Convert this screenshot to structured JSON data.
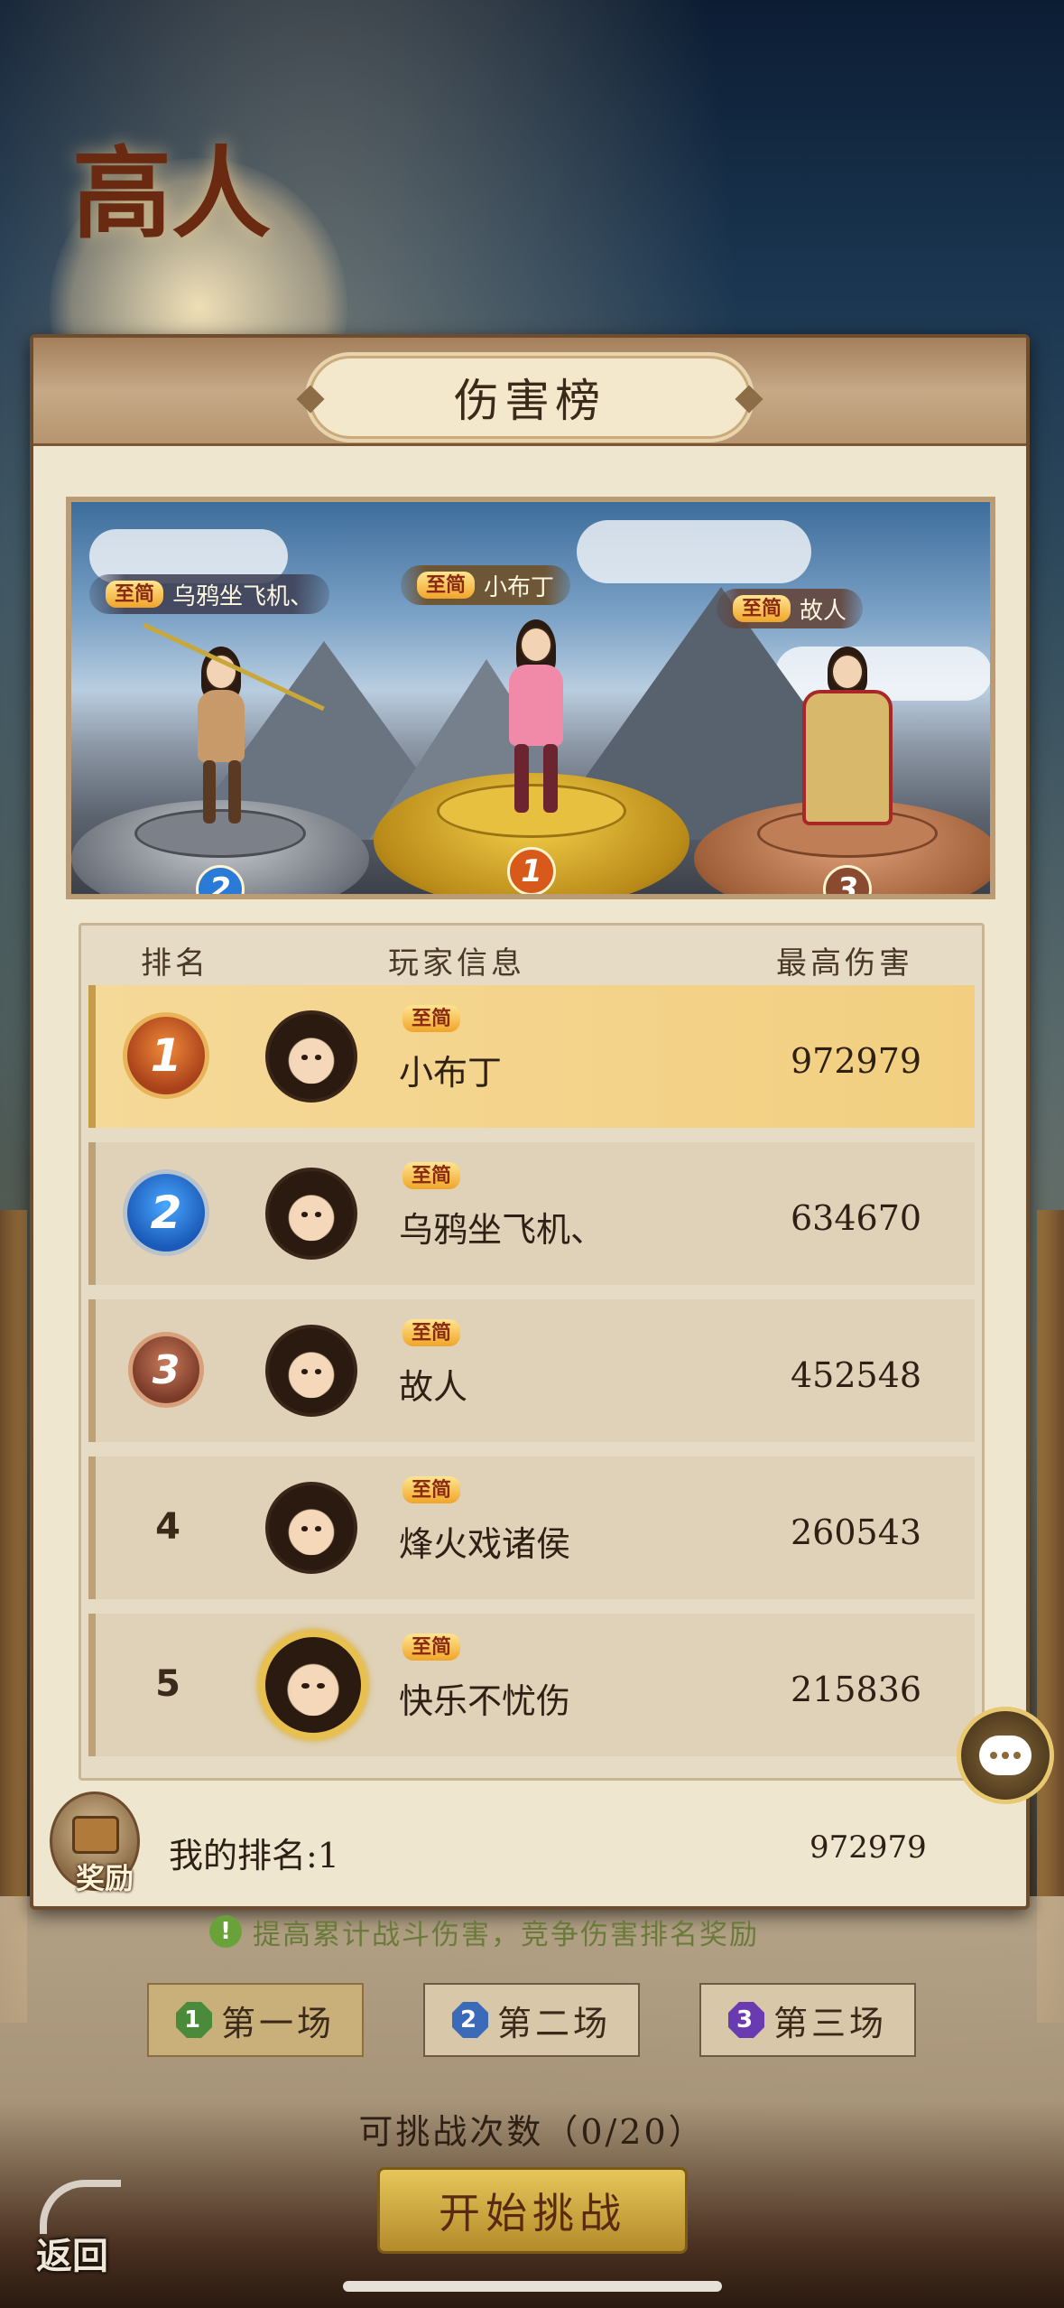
{
  "background": {
    "title": "高人"
  },
  "panel": {
    "title": "伤害榜"
  },
  "podium": [
    {
      "rank": "1",
      "tag": "至简",
      "name": "小布丁"
    },
    {
      "rank": "2",
      "tag": "至简",
      "name": "乌鸦坐飞机、"
    },
    {
      "rank": "3",
      "tag": "至简",
      "name": "故人"
    }
  ],
  "table": {
    "headers": {
      "rank": "排名",
      "player": "玩家信息",
      "damage": "最高伤害"
    },
    "rows": [
      {
        "rank": "1",
        "tag": "至简",
        "name": "小布丁",
        "damage": "972979"
      },
      {
        "rank": "2",
        "tag": "至简",
        "name": "乌鸦坐飞机、",
        "damage": "634670"
      },
      {
        "rank": "3",
        "tag": "至简",
        "name": "故人",
        "damage": "452548"
      },
      {
        "rank": "4",
        "tag": "至简",
        "name": "烽火戏诸侯",
        "damage": "260543"
      },
      {
        "rank": "5",
        "tag": "至简",
        "name": "快乐不忧伤",
        "damage": "215836"
      }
    ]
  },
  "my_rank": {
    "reward_label": "奖励",
    "text": "我的排名:1",
    "damage": "972979"
  },
  "hint": {
    "icon": "!",
    "text": "提高累计战斗伤害，竞争伤害排名奖励"
  },
  "stages": [
    {
      "num": "1",
      "label": "第一场",
      "color": "#4a8a3a"
    },
    {
      "num": "2",
      "label": "第二场",
      "color": "#3a6ab8"
    },
    {
      "num": "3",
      "label": "第三场",
      "color": "#6a3ab0"
    }
  ],
  "attempts": "可挑战次数（0/20）",
  "start_button": "开始挑战",
  "back_button": "返回",
  "colors": {
    "gold": "#e8c050",
    "panel_bg": "#efe6d0",
    "header_brown": "#a47f5c"
  }
}
